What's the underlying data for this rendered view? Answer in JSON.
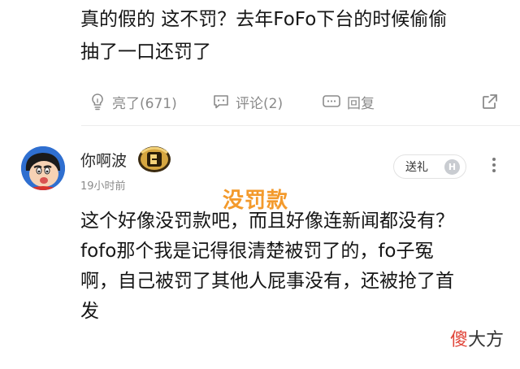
{
  "previous_comment": {
    "line1": "真的假的 这不罚？去年FoFo下台的时候偷偷",
    "line2": "抽了一口还罚了"
  },
  "actions": {
    "like": "亮了(671)",
    "comment": "评论(2)",
    "reply": "回复"
  },
  "comment": {
    "username": "你啊波",
    "timestamp": "19小时前",
    "gift_label": "送礼",
    "gift_badge": "H",
    "line1": "这个好像没罚款吧，而且好像连新闻都没有？",
    "line2": "fofo那个我是记得很清楚被罚了的，fo子冤",
    "line3": "啊，自己被罚了其他人屁事没有，还被抢了首",
    "line4": "发"
  },
  "overlay": {
    "text": "没罚款"
  },
  "watermark": {
    "part1": "傻",
    "part2": "大方"
  },
  "colors": {
    "overlay": "#f39a2c",
    "meta_gray": "#8a8a8a",
    "watermark_red": "#e0463a"
  },
  "icons": [
    "bulb-icon",
    "comment-bubble-icon",
    "reply-bubble-icon",
    "share-icon",
    "level-badge-icon",
    "more-vertical-icon"
  ]
}
